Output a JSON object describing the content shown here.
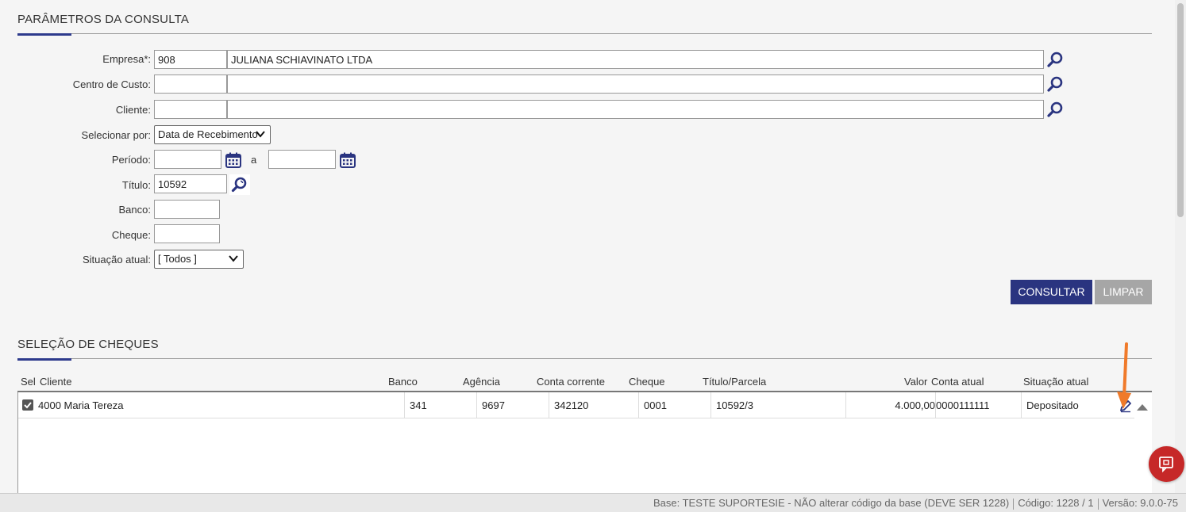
{
  "params": {
    "title": "PARÂMETROS DA CONSULTA",
    "empresa": {
      "label": "Empresa*:",
      "code": "908",
      "name": "JULIANA SCHIAVINATO LTDA"
    },
    "centro_custo": {
      "label": "Centro de Custo:",
      "code": "",
      "name": ""
    },
    "cliente": {
      "label": "Cliente:",
      "code": "",
      "name": ""
    },
    "selecionar_por": {
      "label": "Selecionar por:",
      "value": "Data de Recebimento"
    },
    "periodo": {
      "label": "Período:",
      "separator": "a",
      "from": "",
      "to": ""
    },
    "titulo": {
      "label": "Título:",
      "value": "10592"
    },
    "banco": {
      "label": "Banco:",
      "value": ""
    },
    "cheque": {
      "label": "Cheque:",
      "value": ""
    },
    "situacao": {
      "label": "Situação atual:",
      "value": "[ Todos ]"
    },
    "buttons": {
      "consultar": "CONSULTAR",
      "limpar": "LIMPAR"
    }
  },
  "cheques": {
    "title": "SELEÇÃO DE CHEQUES",
    "columns": {
      "sel": "Sel",
      "cliente": "Cliente",
      "banco": "Banco",
      "agencia": "Agência",
      "conta": "Conta corrente",
      "cheque": "Cheque",
      "titulo": "Título/Parcela",
      "valor": "Valor",
      "conta_atual": "Conta atual",
      "situacao": "Situação atual"
    },
    "rows": [
      {
        "selected": true,
        "cliente": "4000 Maria Tereza",
        "banco": "341",
        "agencia": "9697",
        "conta": "342120",
        "cheque": "0001",
        "titulo": "10592/3",
        "valor": "4.000,00",
        "conta_atual": "0000111111",
        "situacao": "Depositado"
      }
    ]
  },
  "footer": {
    "base": "Base: TESTE SUPORTESIE - NÃO alterar código da base (DEVE SER 1228)",
    "codigo": "Código: 1228 / 1",
    "versao": "Versão: 9.0.0-75"
  },
  "colors": {
    "primary": "#2a3480",
    "disabled": "#a6a6a6",
    "chat": "#c62828",
    "annotation_arrow": "#f07a2a"
  },
  "icons": [
    "search-icon",
    "calendar-icon",
    "chevron-down-icon",
    "edit-icon",
    "collapse-icon",
    "chat-icon",
    "checkbox-checked-icon"
  ]
}
